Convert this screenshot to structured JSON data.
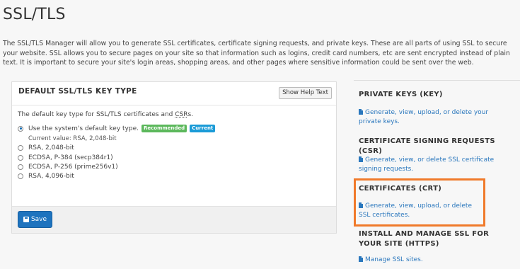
{
  "page": {
    "title": "SSL/TLS",
    "intro": "The SSL/TLS Manager will allow you to generate SSL certificates, certificate signing requests, and private keys. These are all parts of using SSL to secure your website. SSL allows you to secure pages on your site so that information such as logins, credit card numbers, etc are sent encrypted instead of plain text. It is important to secure your site's login areas, shopping areas, and other pages where sensitive information could be sent over the web."
  },
  "keytype_panel": {
    "title": "DEFAULT SSL/TLS KEY TYPE",
    "help_button": "Show Help Text",
    "description_prefix": "The default key type for SSL/TLS certificates and ",
    "description_abbr": "CSR",
    "description_suffix": "s.",
    "options": [
      {
        "label": "Use the system's default key type.",
        "checked": true
      },
      {
        "label": "RSA, 2,048-bit",
        "checked": false
      },
      {
        "label": "ECDSA, P-384 (secp384r1)",
        "checked": false
      },
      {
        "label": "ECDSA, P-256 (prime256v1)",
        "checked": false
      },
      {
        "label": "RSA, 4,096-bit",
        "checked": false
      }
    ],
    "badge_recommended": "Recommended",
    "badge_current": "Current",
    "current_value": "Current value: RSA, 2,048-bit",
    "save_button": "Save",
    "colors": {
      "primary": "#1e73be",
      "recommended": "#5cb85c",
      "current": "#1b9bd7"
    }
  },
  "sidebar": {
    "sections": [
      {
        "heading": "PRIVATE KEYS (KEY)",
        "link": "Generate, view, upload, or delete your private keys."
      },
      {
        "heading": "CERTIFICATE SIGNING REQUESTS (CSR)",
        "link": "Generate, view, or delete SSL certificate signing requests."
      },
      {
        "heading": "CERTIFICATES (CRT)",
        "link": "Generate, view, upload, or delete SSL certificates."
      },
      {
        "heading": "INSTALL AND MANAGE SSL FOR YOUR SITE (HTTPS)",
        "link": "Manage SSL sites."
      }
    ],
    "link_color": "#2a77bd",
    "highlight_color": "#f07a2b"
  }
}
